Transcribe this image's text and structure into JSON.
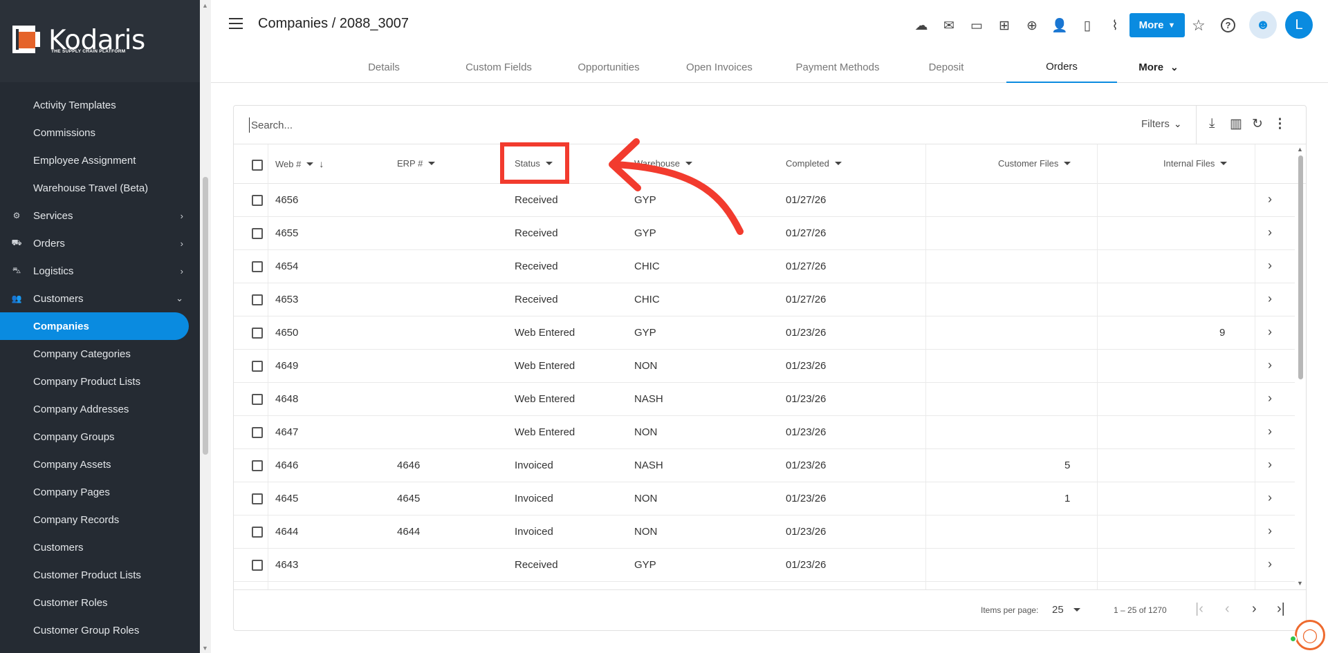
{
  "brand": {
    "name": "Kodaris",
    "tagline": "THE SUPPLY CHAIN PLATFORM"
  },
  "sidebar": {
    "items": [
      {
        "label": "Activity Templates",
        "icon": "",
        "chevron": ""
      },
      {
        "label": "Commissions",
        "icon": "",
        "chevron": ""
      },
      {
        "label": "Employee Assignment",
        "icon": "",
        "chevron": ""
      },
      {
        "label": "Warehouse Travel (Beta)",
        "icon": "",
        "chevron": ""
      },
      {
        "label": "Services",
        "icon": "gears-icon",
        "chevron": "›"
      },
      {
        "label": "Orders",
        "icon": "truck-icon",
        "chevron": "›"
      },
      {
        "label": "Logistics",
        "icon": "delivery-icon",
        "chevron": "›"
      },
      {
        "label": "Customers",
        "icon": "people-icon",
        "chevron": "⌄"
      },
      {
        "label": "Companies",
        "icon": "",
        "chevron": ""
      },
      {
        "label": "Company Categories",
        "icon": "",
        "chevron": ""
      },
      {
        "label": "Company Product Lists",
        "icon": "",
        "chevron": ""
      },
      {
        "label": "Company Addresses",
        "icon": "",
        "chevron": ""
      },
      {
        "label": "Company Groups",
        "icon": "",
        "chevron": ""
      },
      {
        "label": "Company Assets",
        "icon": "",
        "chevron": ""
      },
      {
        "label": "Company Pages",
        "icon": "",
        "chevron": ""
      },
      {
        "label": "Company Records",
        "icon": "",
        "chevron": ""
      },
      {
        "label": "Customers",
        "icon": "",
        "chevron": ""
      },
      {
        "label": "Customer Product Lists",
        "icon": "",
        "chevron": ""
      },
      {
        "label": "Customer Roles",
        "icon": "",
        "chevron": ""
      },
      {
        "label": "Customer Group Roles",
        "icon": "",
        "chevron": ""
      }
    ]
  },
  "header": {
    "title": "Companies / 2088_3007",
    "more_label": "More",
    "avatar_letter": "L"
  },
  "tabs": [
    {
      "label": "Details"
    },
    {
      "label": "Custom Fields"
    },
    {
      "label": "Opportunities"
    },
    {
      "label": "Open Invoices"
    },
    {
      "label": "Payment Methods"
    },
    {
      "label": "Deposit"
    },
    {
      "label": "Orders"
    },
    {
      "label": "More"
    }
  ],
  "grid": {
    "search_placeholder": "Search...",
    "filters_label": "Filters",
    "columns": [
      {
        "label": "Web #"
      },
      {
        "label": "ERP #"
      },
      {
        "label": "Status"
      },
      {
        "label": "Warehouse"
      },
      {
        "label": "Completed"
      },
      {
        "label": "Customer Files"
      },
      {
        "label": "Internal Files"
      }
    ],
    "rows": [
      {
        "web": "4656",
        "erp": "",
        "status": "Received",
        "warehouse": "GYP",
        "completed": "01/27/26",
        "customer_files": "",
        "internal_files": ""
      },
      {
        "web": "4655",
        "erp": "",
        "status": "Received",
        "warehouse": "GYP",
        "completed": "01/27/26",
        "customer_files": "",
        "internal_files": ""
      },
      {
        "web": "4654",
        "erp": "",
        "status": "Received",
        "warehouse": "CHIC",
        "completed": "01/27/26",
        "customer_files": "",
        "internal_files": ""
      },
      {
        "web": "4653",
        "erp": "",
        "status": "Received",
        "warehouse": "CHIC",
        "completed": "01/27/26",
        "customer_files": "",
        "internal_files": ""
      },
      {
        "web": "4650",
        "erp": "",
        "status": "Web Entered",
        "warehouse": "GYP",
        "completed": "01/23/26",
        "customer_files": "",
        "internal_files": "9"
      },
      {
        "web": "4649",
        "erp": "",
        "status": "Web Entered",
        "warehouse": "NON",
        "completed": "01/23/26",
        "customer_files": "",
        "internal_files": ""
      },
      {
        "web": "4648",
        "erp": "",
        "status": "Web Entered",
        "warehouse": "NASH",
        "completed": "01/23/26",
        "customer_files": "",
        "internal_files": ""
      },
      {
        "web": "4647",
        "erp": "",
        "status": "Web Entered",
        "warehouse": "NON",
        "completed": "01/23/26",
        "customer_files": "",
        "internal_files": ""
      },
      {
        "web": "4646",
        "erp": "4646",
        "status": "Invoiced",
        "warehouse": "NASH",
        "completed": "01/23/26",
        "customer_files": "5",
        "internal_files": ""
      },
      {
        "web": "4645",
        "erp": "4645",
        "status": "Invoiced",
        "warehouse": "NON",
        "completed": "01/23/26",
        "customer_files": "1",
        "internal_files": ""
      },
      {
        "web": "4644",
        "erp": "4644",
        "status": "Invoiced",
        "warehouse": "NON",
        "completed": "01/23/26",
        "customer_files": "",
        "internal_files": ""
      },
      {
        "web": "4643",
        "erp": "",
        "status": "Received",
        "warehouse": "GYP",
        "completed": "01/23/26",
        "customer_files": "",
        "internal_files": ""
      }
    ]
  },
  "pager": {
    "items_label": "Items per page:",
    "page_size": "25",
    "range": "1 – 25 of 1270"
  },
  "colors": {
    "accent": "#0a8be0",
    "sidebar_bg": "#252b33",
    "annotation_red": "#f23b2e",
    "brand_orange": "#e5632a"
  }
}
